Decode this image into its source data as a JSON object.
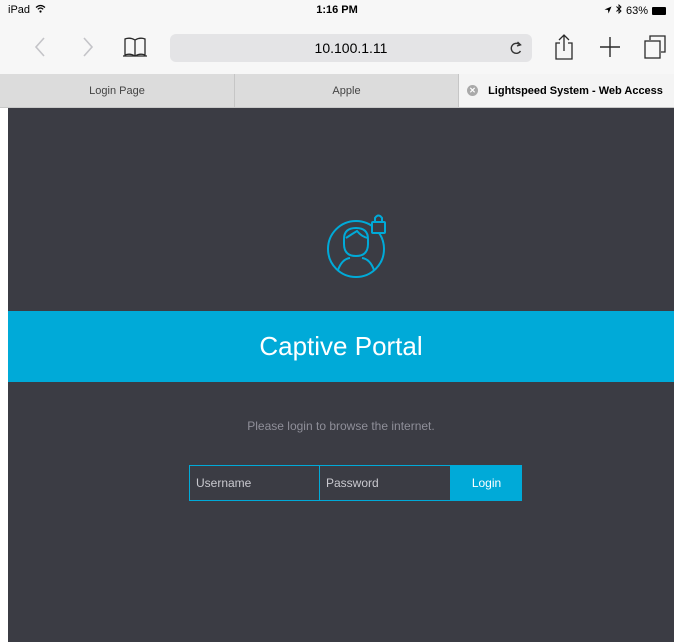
{
  "status_bar": {
    "device": "iPad",
    "time": "1:16 PM",
    "battery": "63%"
  },
  "toolbar": {
    "url": "10.100.1.11",
    "icons": [
      "back-icon",
      "forward-icon",
      "bookmarks-icon",
      "reload-icon",
      "share-icon",
      "new-tab-icon",
      "tabs-icon"
    ]
  },
  "tabs": [
    {
      "label": "Login Page",
      "active": false
    },
    {
      "label": "Apple",
      "active": false
    },
    {
      "label": "Lightspeed System - Web Access",
      "active": true
    }
  ],
  "page": {
    "title": "Captive Portal",
    "prompt": "Please login to browse the internet.",
    "username_placeholder": "Username",
    "password_placeholder": "Password",
    "login_label": "Login"
  },
  "colors": {
    "accent": "#00aad8",
    "page_background": "#3b3c44",
    "browser_chrome": "#f7f7f7",
    "tab_bar": "#dcdcdc",
    "active_tab": "#f4f4f4"
  }
}
